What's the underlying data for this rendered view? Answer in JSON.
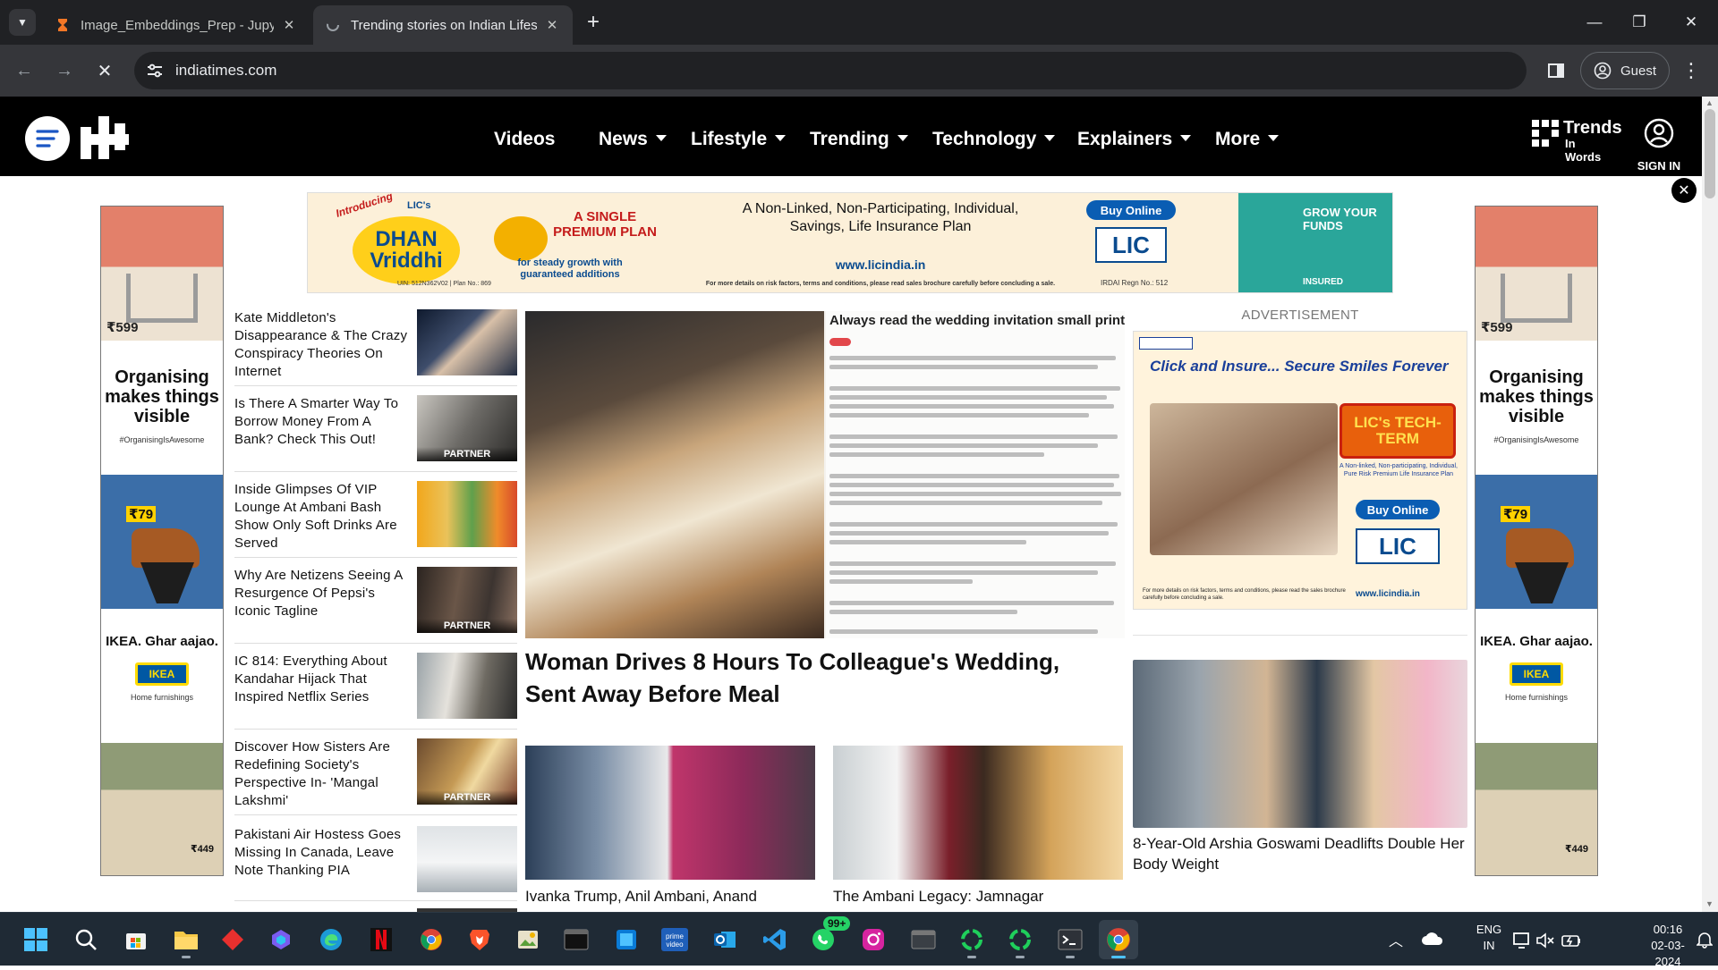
{
  "browser": {
    "tabs": [
      {
        "title": "Image_Embeddings_Prep - Jupyter Notebook",
        "active": false
      },
      {
        "title": "Trending stories on Indian Lifestyle",
        "active": true
      }
    ],
    "url": "indiatimes.com",
    "profile_label": "Guest"
  },
  "site": {
    "nav": [
      "Videos",
      "News",
      "Lifestyle",
      "Trending",
      "Technology",
      "Explainers",
      "More"
    ],
    "trends_big": "Trends",
    "trends_small": "In Words",
    "sign_in": "SIGN IN"
  },
  "skyscraper_ad": {
    "price1": "₹599",
    "headline": "Organising makes things visible",
    "hashtag": "#OrganisingIsAwesome",
    "price2": "₹79",
    "brand_line": "IKEA. Ghar aajao.",
    "logo": "IKEA",
    "sub": "Home furnishings",
    "price3": "₹449"
  },
  "banner_ad": {
    "intro": "Introducing",
    "lic_small": "LIC's",
    "logo_line1": "DHAN",
    "logo_line2": "Vriddhi",
    "uin": "UIN: 512N362V02 | Plan No.: 869",
    "single_premium": "A SINGLE PREMIUM PLAN",
    "steady": "for steady growth with guaranteed additions",
    "description": "A Non-Linked, Non-Participating, Individual, Savings, Life Insurance Plan",
    "url": "www.licindia.in",
    "disclaimer": "For more details on risk factors, terms and conditions, please read sales brochure carefully before concluding a sale.",
    "buy_online": "Buy Online",
    "lic_logo": "LIC",
    "irdai": "IRDAI Regn No.: 512",
    "grow": "GROW YOUR FUNDS",
    "insured": "INSURED"
  },
  "articles": [
    {
      "title": "Kate Middleton's Disappearance & The Crazy Conspiracy Theories On Internet",
      "partner": ""
    },
    {
      "title": "Is There A Smarter Way To Borrow Money From A Bank? Check This Out!",
      "partner": "PARTNER"
    },
    {
      "title": "Inside Glimpses Of VIP Lounge At Ambani Bash Show Only Soft Drinks Are Served",
      "partner": ""
    },
    {
      "title": "Why Are Netizens Seeing A Resurgence Of Pepsi's Iconic Tagline",
      "partner": "PARTNER"
    },
    {
      "title": "IC 814: Everything About Kandahar Hijack That Inspired Netflix Series",
      "partner": ""
    },
    {
      "title": "Discover How Sisters Are Redefining Society's Perspective In- 'Mangal Lakshmi'",
      "partner": "PARTNER"
    },
    {
      "title": "Pakistani Air Hostess Goes Missing In Canada, Leave Note Thanking PIA",
      "partner": ""
    }
  ],
  "hero": {
    "paper_heading": "Always read the wedding invitation small print",
    "title": "Woman Drives 8 Hours To Colleague's Wedding, Sent Away Before Meal"
  },
  "cards": [
    {
      "title": "Ivanka Trump, Anil Ambani, Anand"
    },
    {
      "title": "The Ambani Legacy: Jamnagar"
    }
  ],
  "right_column": {
    "ad_label": "ADVERTISEMENT",
    "ad_click": "Click and Insure... Secure Smiles Forever",
    "ad_product": "LIC's TECH-TERM",
    "ad_small": "A Non-linked, Non-participating, Individual, Pure Risk Premium Life Insurance Plan",
    "ad_buy": "Buy Online",
    "ad_logo": "LIC",
    "ad_url": "www.licindia.in",
    "ad_disclaimer": "For more details on risk factors, terms and conditions, please read the sales brochure carefully before concluding a sale.",
    "story_title": "8-Year-Old Arshia Goswami Deadlifts Double Her Body Weight"
  },
  "taskbar": {
    "apps": [
      "start",
      "search",
      "store",
      "file-explorer",
      "app-red",
      "app-copilot",
      "edge",
      "netflix",
      "chrome",
      "brave",
      "app-image",
      "terminal",
      "app-blue",
      "prime-video",
      "outlook",
      "vscode",
      "whatsapp",
      "instagram",
      "app-window",
      "app-green-1",
      "app-green-2",
      "terminal-2",
      "chrome-active"
    ],
    "whatsapp_badge": "99+",
    "lang_line1": "ENG",
    "lang_line2": "IN",
    "time": "00:16",
    "date": "02-03-2024"
  }
}
